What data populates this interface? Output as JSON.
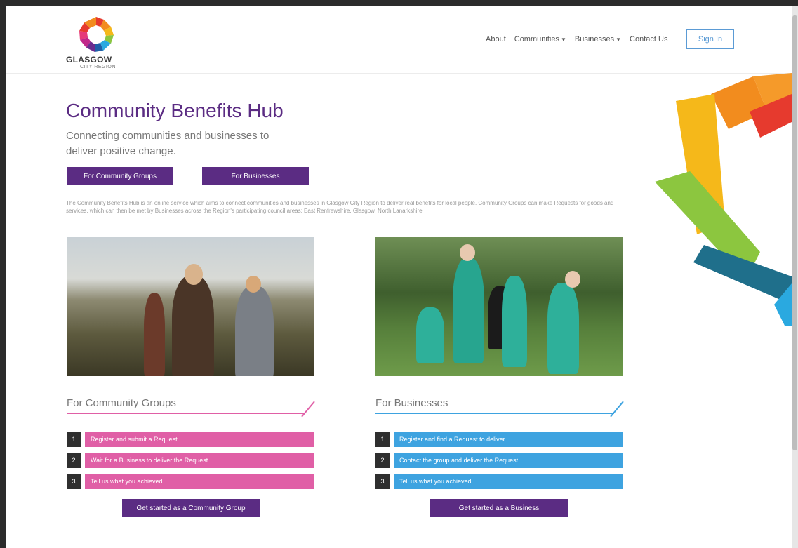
{
  "logo": {
    "name": "GLASGOW",
    "sub": "CITY REGION"
  },
  "nav": {
    "about": "About",
    "communities": "Communities",
    "businesses": "Businesses",
    "contact": "Contact Us",
    "signin": "Sign In"
  },
  "hero": {
    "title": "Community Benefits Hub",
    "subtitle": "Connecting communities and businesses to deliver positive change.",
    "btn_community": "For Community Groups",
    "btn_business": "For Businesses"
  },
  "intro": "The Community Benefits Hub is an online service which aims to connect communities and businesses in Glasgow City Region to deliver real benefits for local people. Community Groups can make Requests for goods and services, which can then be met by Businesses across the Region's participating council areas: East Renfrewshire, Glasgow, North Lanarkshire.",
  "community": {
    "title": "For Community Groups",
    "steps": [
      {
        "num": "1",
        "label": "Register and submit a Request"
      },
      {
        "num": "2",
        "label": "Wait for a Business to deliver the Request"
      },
      {
        "num": "3",
        "label": "Tell us what you achieved"
      }
    ],
    "cta": "Get started as a Community Group"
  },
  "business": {
    "title": "For Businesses",
    "steps": [
      {
        "num": "1",
        "label": "Register and find a Request to deliver"
      },
      {
        "num": "2",
        "label": "Contact the group and deliver the Request"
      },
      {
        "num": "3",
        "label": "Tell us what you achieved"
      }
    ],
    "cta": "Get started as a Business"
  },
  "colors": {
    "purple": "#5b2c83",
    "pink": "#e05fa6",
    "blue": "#3ea3e0",
    "outline_blue": "#5b9bd5"
  }
}
